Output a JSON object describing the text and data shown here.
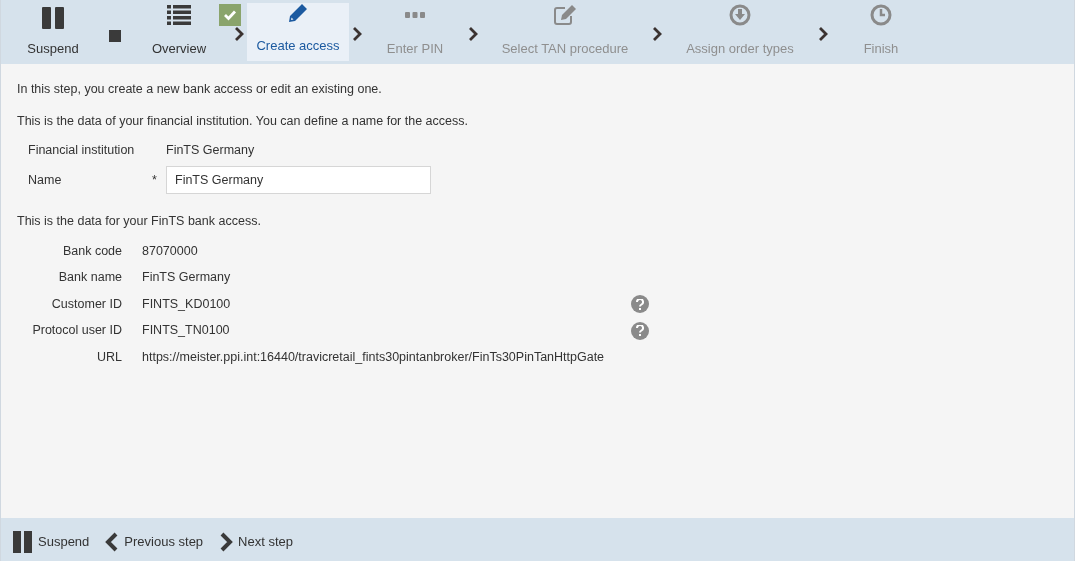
{
  "toolbar": {
    "suspend_label": "Suspend",
    "steps": [
      {
        "label": "Overview",
        "done": true,
        "selected": false,
        "disabled": false
      },
      {
        "label": "Create access",
        "done": false,
        "selected": true,
        "disabled": false
      },
      {
        "label": "Enter PIN",
        "done": false,
        "selected": false,
        "disabled": true
      },
      {
        "label": "Select TAN procedure",
        "done": false,
        "selected": false,
        "disabled": true
      },
      {
        "label": "Assign order types",
        "done": false,
        "selected": false,
        "disabled": true
      },
      {
        "label": "Finish",
        "done": false,
        "selected": false,
        "disabled": true
      }
    ]
  },
  "intro": "In this step, you create a new bank access or edit an existing one.",
  "institution": {
    "heading": "This is the data of your financial institution. You can define a name for the access.",
    "institution_label": "Financial institution",
    "institution_value": "FinTS Germany",
    "name_label": "Name",
    "required_mark": "*",
    "name_value": "FinTS Germany"
  },
  "access": {
    "heading": "This is the data for your FinTS bank access.",
    "rows": [
      {
        "label": "Bank code",
        "value": "87070000",
        "help": false
      },
      {
        "label": "Bank name",
        "value": "FinTS Germany",
        "help": false
      },
      {
        "label": "Customer ID",
        "value": "FINTS_KD0100",
        "help": true
      },
      {
        "label": "Protocol user ID",
        "value": "FINTS_TN0100",
        "help": true
      },
      {
        "label": "URL",
        "value": "https://meister.ppi.int:16440/travicretail_fints30pintanbroker/FinTs30PinTanHttpGate",
        "help": false
      }
    ]
  },
  "footer": [
    {
      "kind": "pause",
      "label": "Suspend"
    },
    {
      "kind": "previous",
      "label": "Previous step"
    },
    {
      "kind": "next",
      "label": "Next step"
    }
  ]
}
